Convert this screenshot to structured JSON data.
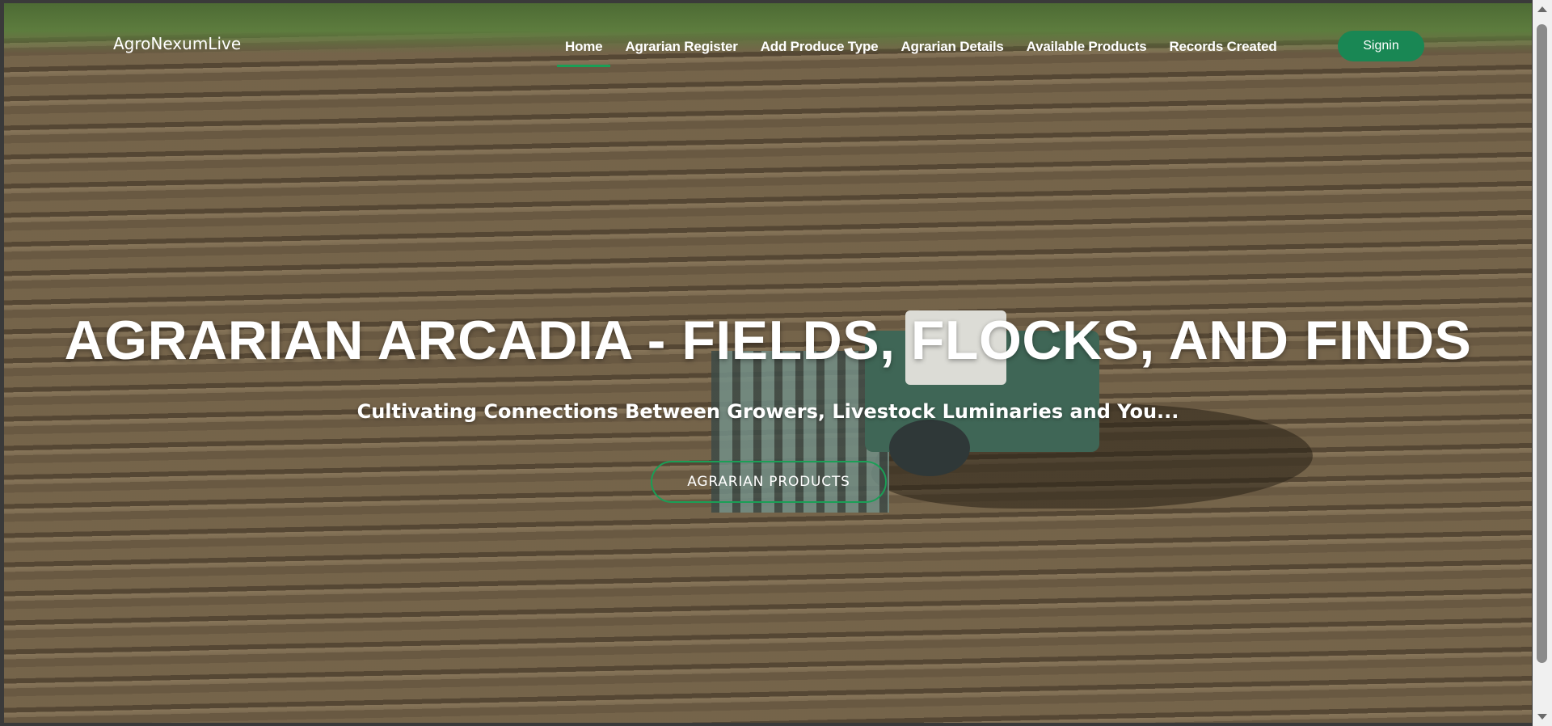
{
  "brand": {
    "name": "AgroNexumLive"
  },
  "nav": {
    "items": [
      {
        "label": "Home",
        "active": true
      },
      {
        "label": "Agrarian Register",
        "active": false
      },
      {
        "label": "Add Produce Type",
        "active": false
      },
      {
        "label": "Agrarian Details",
        "active": false
      },
      {
        "label": "Available Products",
        "active": false
      },
      {
        "label": "Records Created",
        "active": false
      }
    ],
    "signin_label": "Signin"
  },
  "hero": {
    "title": "AGRARIAN ARCADIA - FIELDS, FLOCKS, AND FINDS",
    "subtitle": "Cultivating Connections Between Growers, Livestock Luminaries and You...",
    "cta_label": "AGRARIAN PRODUCTS"
  },
  "colors": {
    "accent": "#198754",
    "text": "#ffffff"
  }
}
